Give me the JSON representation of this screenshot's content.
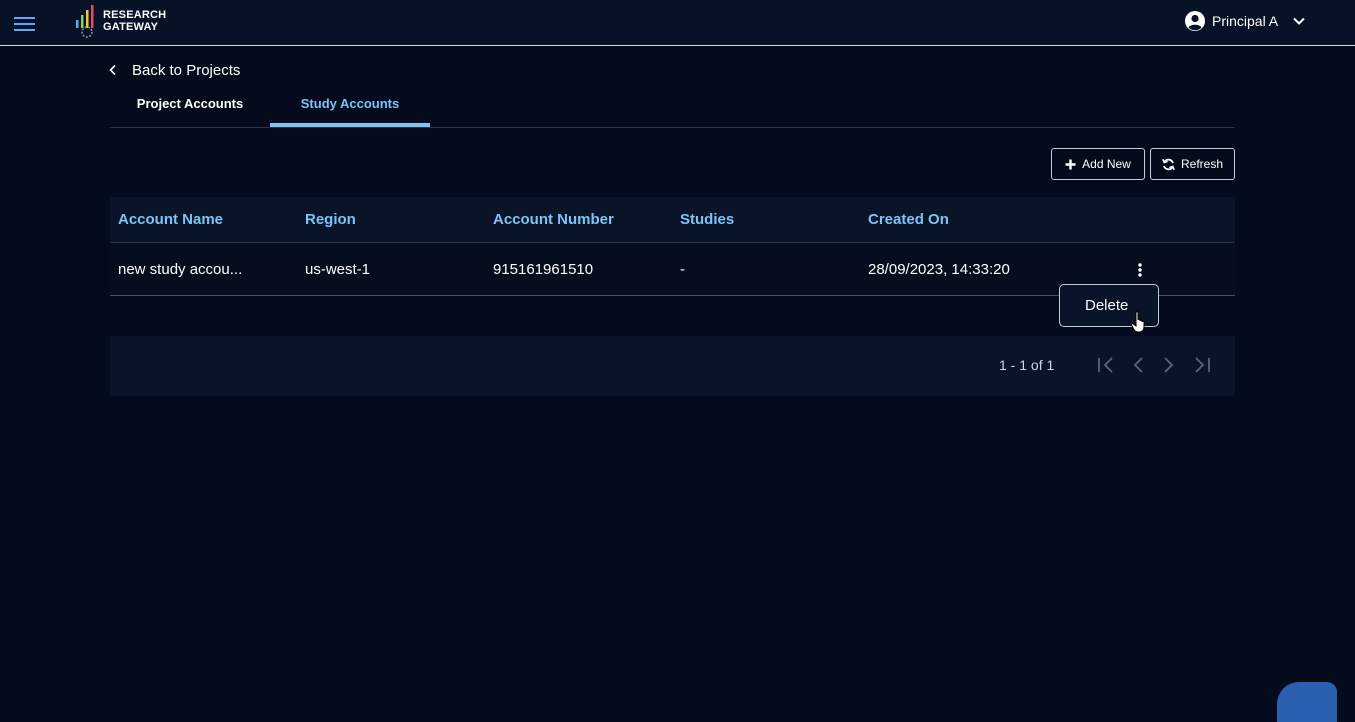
{
  "header": {
    "logo_line1": "RESEARCH",
    "logo_line2": "GATEWAY",
    "user_name": "Principal A",
    "icons": [
      "menu-icon",
      "user-circle-icon",
      "chevron-down-icon"
    ]
  },
  "nav": {
    "back_label": "Back to Projects"
  },
  "tabs": [
    {
      "label": "Project Accounts",
      "active": false
    },
    {
      "label": "Study Accounts",
      "active": true
    }
  ],
  "toolbar": {
    "add_label": "Add New",
    "refresh_label": "Refresh"
  },
  "table": {
    "columns": [
      "Account Name",
      "Region",
      "Account Number",
      "Studies",
      "Created On"
    ],
    "rows": [
      {
        "account_name": "new study accou...",
        "region": "us-west-1",
        "account_number": "915161961510",
        "studies": "-",
        "created_on": "28/09/2023, 14:33:20"
      }
    ]
  },
  "row_menu": {
    "delete_label": "Delete"
  },
  "pagination": {
    "range": "1 - 1 of 1"
  },
  "colors": {
    "background": "#030b1c",
    "accent": "#7cc4f5",
    "menu_icon": "#5ea9ff"
  }
}
